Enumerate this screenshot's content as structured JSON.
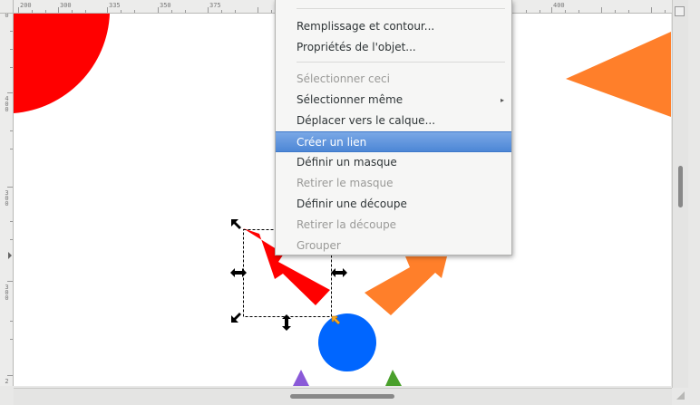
{
  "rulers": {
    "top_ticks": [
      "200",
      "300",
      "335",
      "350",
      "375",
      "400"
    ],
    "left_ticks": [
      "0",
      "4\n0\n0",
      "3\n0\n0",
      "3\n0\n0",
      "2"
    ]
  },
  "canvas": {
    "shapes": [
      {
        "name": "red-quarter-circle",
        "color": "#ff0000"
      },
      {
        "name": "orange-triangle",
        "color": "#ff7f2a"
      },
      {
        "name": "red-arrow-selected",
        "color": "#ff0000"
      },
      {
        "name": "orange-arrow",
        "color": "#ff7f2a"
      },
      {
        "name": "blue-circle",
        "color": "#0066ff"
      },
      {
        "name": "purple-triangle",
        "color": "#8a5ad8"
      },
      {
        "name": "green-triangle",
        "color": "#4aa02c"
      }
    ],
    "selection_handle_color": "#000000",
    "rotation_center_color": "#f5a623"
  },
  "context_menu": {
    "items": [
      {
        "label": "Remplissage et contour...",
        "disabled": false,
        "selected": false,
        "submenu": false
      },
      {
        "label": "Propriétés de l'objet...",
        "disabled": false,
        "selected": false,
        "submenu": false
      },
      {
        "label": "Sélectionner ceci",
        "disabled": true,
        "selected": false,
        "submenu": false
      },
      {
        "label": "Sélectionner même",
        "disabled": false,
        "selected": false,
        "submenu": true
      },
      {
        "label": "Déplacer vers le calque...",
        "disabled": false,
        "selected": false,
        "submenu": false
      },
      {
        "label": "Créer un lien",
        "disabled": false,
        "selected": true,
        "submenu": false
      },
      {
        "label": "Définir un masque",
        "disabled": false,
        "selected": false,
        "submenu": false
      },
      {
        "label": "Retirer le masque",
        "disabled": true,
        "selected": false,
        "submenu": false
      },
      {
        "label": "Définir une découpe",
        "disabled": false,
        "selected": false,
        "submenu": false
      },
      {
        "label": "Retirer la découpe",
        "disabled": true,
        "selected": false,
        "submenu": false
      },
      {
        "label": "Grouper",
        "disabled": true,
        "selected": false,
        "submenu": false
      }
    ],
    "submenu_arrow": "▸",
    "accent_color": "#4d87d6"
  }
}
